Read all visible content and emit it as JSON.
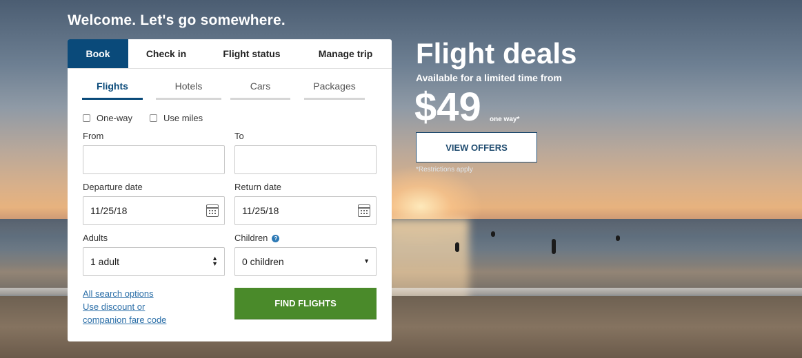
{
  "welcome": "Welcome. Let's go somewhere.",
  "tabs": [
    {
      "label": "Book",
      "active": true
    },
    {
      "label": "Check in"
    },
    {
      "label": "Flight status"
    },
    {
      "label": "Manage trip"
    }
  ],
  "subtabs": [
    {
      "label": "Flights",
      "active": true
    },
    {
      "label": "Hotels"
    },
    {
      "label": "Cars"
    },
    {
      "label": "Packages"
    }
  ],
  "options": {
    "one_way": "One-way",
    "use_miles": "Use miles"
  },
  "form": {
    "from_label": "From",
    "to_label": "To",
    "from_value": "",
    "to_value": "",
    "departure_label": "Departure date",
    "departure_value": "11/25/18",
    "return_label": "Return date",
    "return_value": "11/25/18",
    "adults_label": "Adults",
    "adults_value": "1 adult",
    "children_label": "Children",
    "children_value": "0 children",
    "help_icon": "?"
  },
  "links": {
    "all_search": "All search options",
    "discount_line1": "Use discount or",
    "discount_line2": "companion fare code"
  },
  "find_button": "FIND FLIGHTS",
  "deal": {
    "title": "Flight deals",
    "subtitle": "Available for a limited time from",
    "price": "$49",
    "one_way": "one way*",
    "button": "VIEW OFFERS",
    "restrictions": "*Restrictions apply"
  },
  "colors": {
    "brand_blue": "#0a4a7a",
    "find_green": "#4a8a2a",
    "link_blue": "#2c6fa8"
  },
  "icons": [
    "calendar-icon",
    "help-icon",
    "select-arrow-icon"
  ]
}
